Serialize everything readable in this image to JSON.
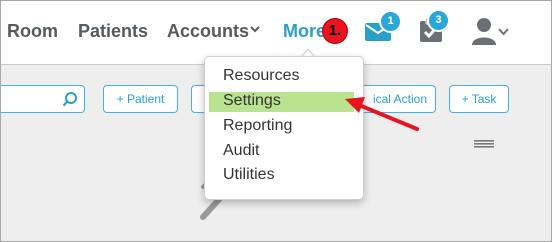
{
  "nav": {
    "room": "Room",
    "patients": "Patients",
    "accounts": "Accounts",
    "more": "More"
  },
  "callout": "1.",
  "mail_badge": "1",
  "task_badge": "3",
  "toolbar": {
    "add_patient": "+ Patient",
    "clinical_action": "ical Action",
    "add_task": "+ Task"
  },
  "menu": {
    "items": [
      "Resources",
      "Settings",
      "Reporting",
      "Audit",
      "Utilities"
    ],
    "highlighted": "Settings"
  },
  "colors": {
    "accent": "#2a9fc8",
    "highlight": "#b9e38f",
    "callout": "#e8141e",
    "arrow": "#e8141e"
  }
}
